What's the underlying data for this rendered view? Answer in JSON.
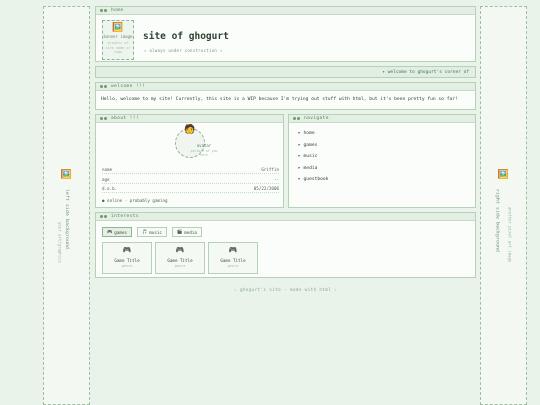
{
  "left_sidebar": {
    "icon": "picture-icon",
    "label": "left side background",
    "sub": "your art/graphics"
  },
  "right_sidebar": {
    "icon": "picture-icon",
    "label": "right side background",
    "sub": "another pixel art image"
  },
  "home": {
    "title": "home",
    "banner": {
      "icon": "picture-icon",
      "label": "banner image",
      "caption": "graphic of site name or logo"
    },
    "site_title": "site of ghogurt",
    "subtitle": "✦ always under construction ✦"
  },
  "ticker": {
    "text": "✦   welcome to ghogurt's corner of"
  },
  "welcome": {
    "title": "welcome !!!",
    "text": "Hello, welcome to my site! Currently, this site is a WIP because I'm trying out stuff with html, but it's been pretty fun so far!"
  },
  "about": {
    "title": "about !!!",
    "avatar": {
      "icon": "person-emoji",
      "label": "avatar",
      "caption": "picture of you here"
    },
    "rows": [
      {
        "label": "name",
        "value": "Griffin"
      },
      {
        "label": "age",
        "value": "--"
      },
      {
        "label": "d.o.b.",
        "value": "05/22/2006"
      }
    ],
    "status": "● online · probably gaming"
  },
  "navigate": {
    "title": "navigate",
    "items": [
      "▸ home",
      "▸ games",
      "▸ music",
      "▸ media",
      "▸ guestbook"
    ]
  },
  "interests": {
    "title": "interests",
    "tabs": [
      {
        "icon": "🎮",
        "label": "games"
      },
      {
        "icon": "🎵",
        "label": "music"
      },
      {
        "icon": "🎬",
        "label": "media"
      }
    ],
    "cards": [
      {
        "icon": "gamepad-icon",
        "title": "Game Title",
        "genre": "genre"
      },
      {
        "icon": "gamepad-icon",
        "title": "Game Title",
        "genre": "genre"
      },
      {
        "icon": "gamepad-icon",
        "title": "Game Title",
        "genre": "genre"
      }
    ]
  },
  "footer": {
    "text": "✧ ghogurt's site · made with html ✧"
  }
}
